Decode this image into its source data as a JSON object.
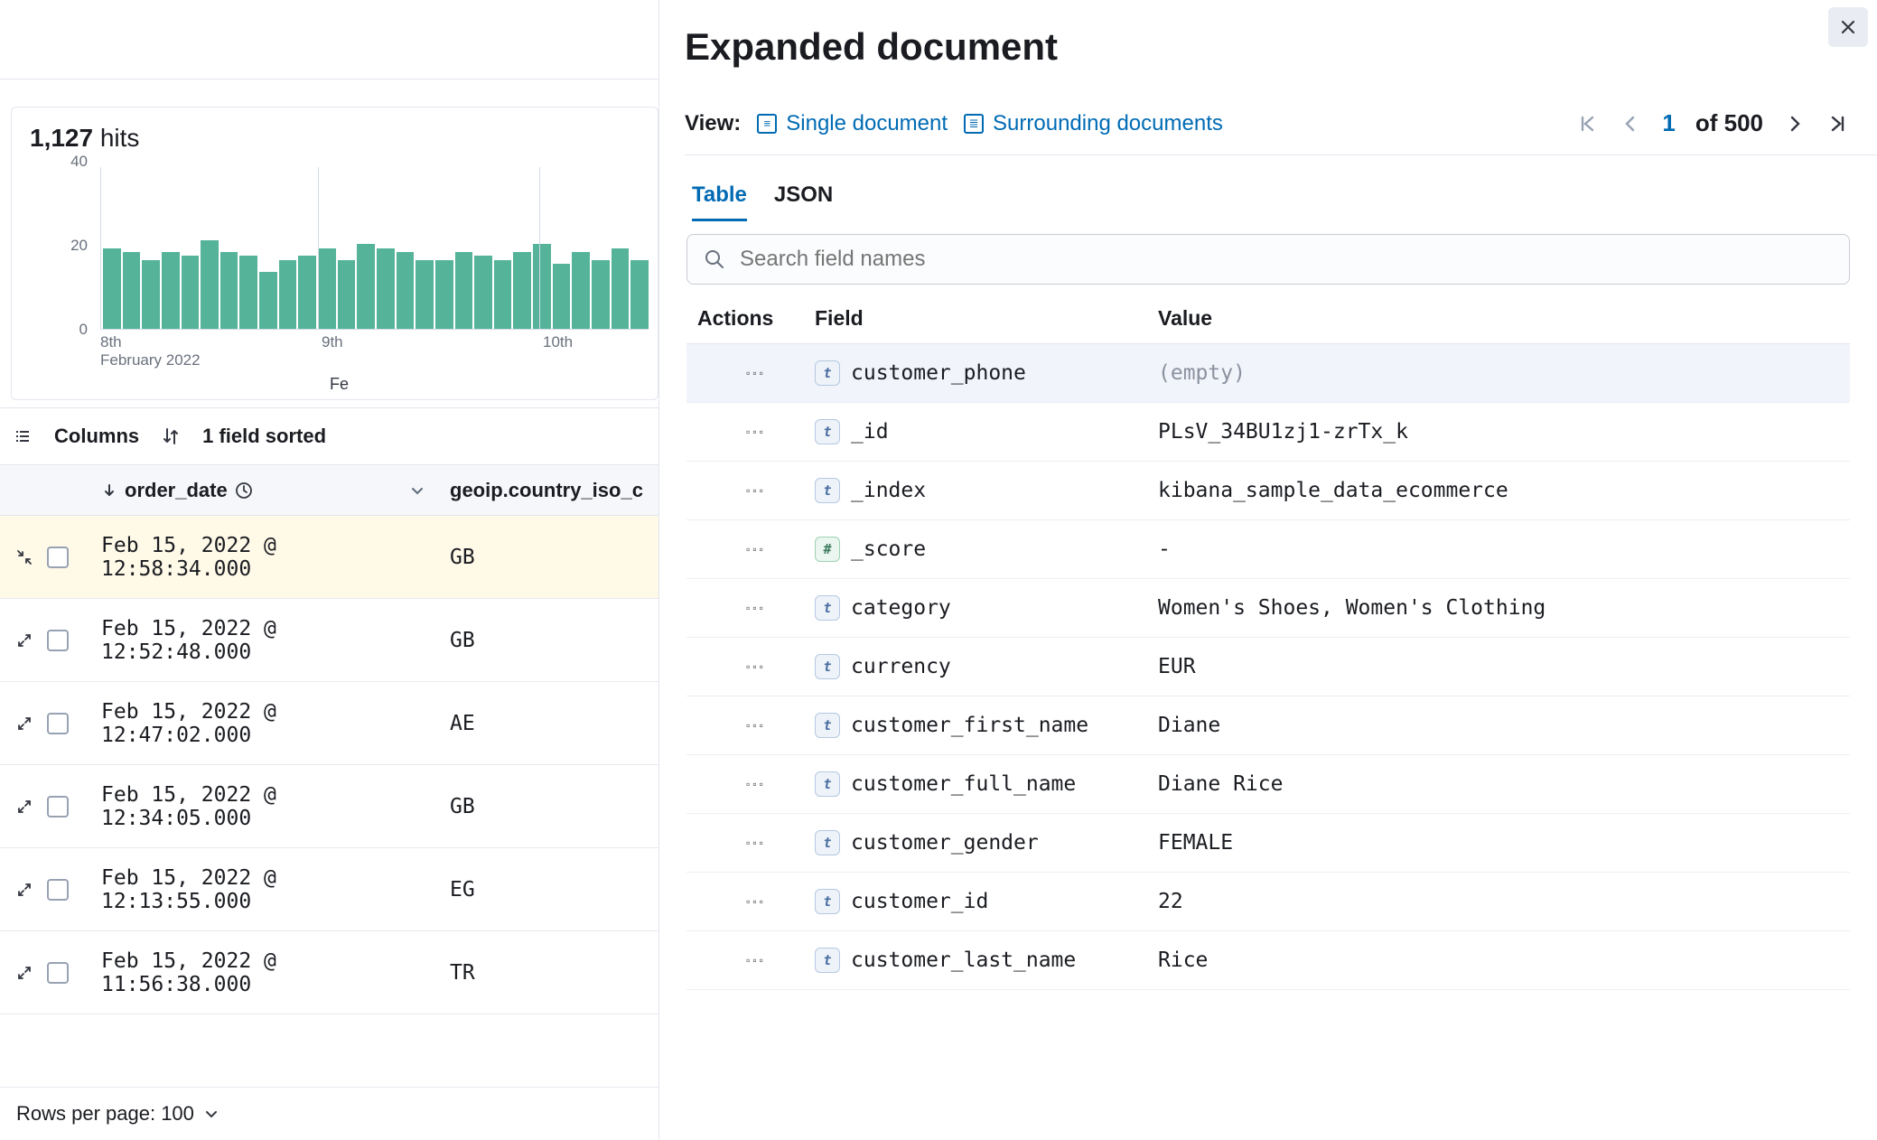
{
  "hits": {
    "count_formatted": "1,127",
    "label": "hits"
  },
  "chart_data": {
    "type": "bar",
    "title": "",
    "xlabel": "Fe",
    "ylabel": "",
    "ylim": [
      0,
      40
    ],
    "y_ticks": [
      0,
      20,
      40
    ],
    "x_month_label": "February 2022",
    "x_ticks": [
      "8th",
      "9th",
      "10th"
    ],
    "values": [
      20,
      19,
      17,
      19,
      18,
      22,
      19,
      18,
      14,
      17,
      18,
      20,
      17,
      21,
      20,
      19,
      17,
      17,
      19,
      18,
      17,
      19,
      21,
      16,
      19,
      17,
      20,
      17
    ]
  },
  "toolbar": {
    "columns_label": "Columns",
    "sorted_label": "1 field sorted"
  },
  "grid": {
    "headers": {
      "order_date": "order_date",
      "geo": "geoip.country_iso_c"
    },
    "rows": [
      {
        "date": "Feb 15, 2022 @ 12:58:34.000",
        "geo": "GB",
        "selected": true
      },
      {
        "date": "Feb 15, 2022 @ 12:52:48.000",
        "geo": "GB",
        "selected": false
      },
      {
        "date": "Feb 15, 2022 @ 12:47:02.000",
        "geo": "AE",
        "selected": false
      },
      {
        "date": "Feb 15, 2022 @ 12:34:05.000",
        "geo": "GB",
        "selected": false
      },
      {
        "date": "Feb 15, 2022 @ 12:13:55.000",
        "geo": "EG",
        "selected": false
      },
      {
        "date": "Feb 15, 2022 @ 11:56:38.000",
        "geo": "TR",
        "selected": false
      }
    ],
    "rows_per_page_label": "Rows per page: 100"
  },
  "flyout": {
    "title": "Expanded document",
    "view_label": "View:",
    "single_doc": "Single document",
    "surrounding": "Surrounding documents",
    "pager": {
      "current": "1",
      "of": "of",
      "total": "500"
    },
    "tabs": {
      "table": "Table",
      "json": "JSON"
    },
    "search_placeholder": "Search field names",
    "headers": {
      "actions": "Actions",
      "field": "Field",
      "value": "Value"
    },
    "fields": [
      {
        "type": "t",
        "name": "customer_phone",
        "value": "(empty)",
        "muted": true,
        "pinned": true
      },
      {
        "type": "t",
        "name": "_id",
        "value": "PLsV_34BU1zj1-zrTx_k"
      },
      {
        "type": "t",
        "name": "_index",
        "value": "kibana_sample_data_ecommerce"
      },
      {
        "type": "#",
        "name": "_score",
        "value": " - "
      },
      {
        "type": "t",
        "name": "category",
        "value": "Women's Shoes, Women's Clothing"
      },
      {
        "type": "t",
        "name": "currency",
        "value": "EUR"
      },
      {
        "type": "t",
        "name": "customer_first_name",
        "value": "Diane"
      },
      {
        "type": "t",
        "name": "customer_full_name",
        "value": "Diane Rice"
      },
      {
        "type": "t",
        "name": "customer_gender",
        "value": "FEMALE"
      },
      {
        "type": "t",
        "name": "customer_id",
        "value": "22"
      },
      {
        "type": "t",
        "name": "customer_last_name",
        "value": "Rice"
      }
    ]
  }
}
